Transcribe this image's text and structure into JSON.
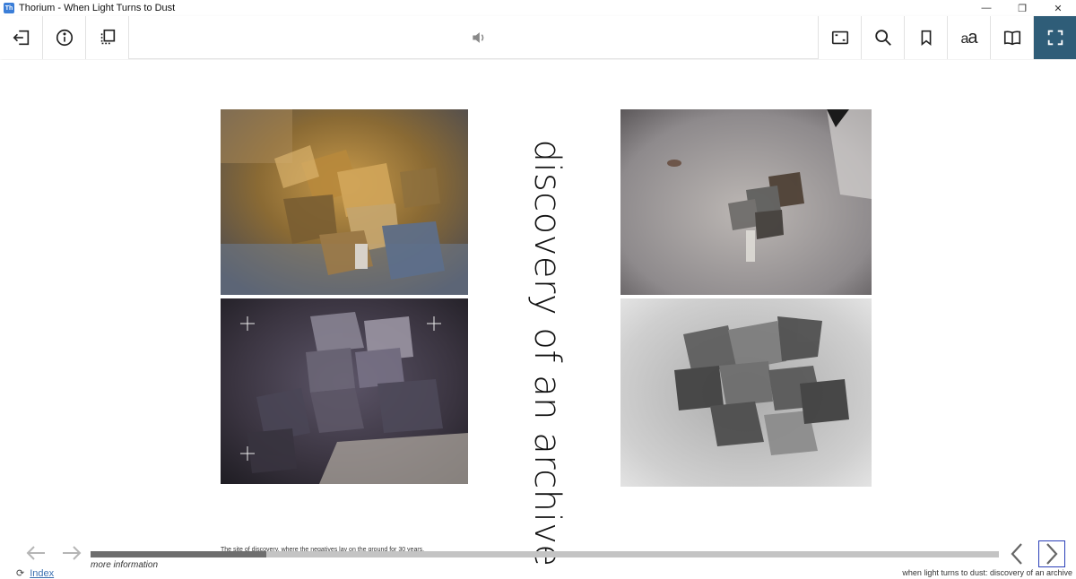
{
  "window": {
    "app_logo": "Th",
    "title": "Thorium - When Light Turns to Dust",
    "controls": [
      "minimize-icon",
      "restore-icon",
      "close-icon"
    ],
    "minimize_glyph": "—",
    "restore_glyph": "❐",
    "close_glyph": "✕"
  },
  "toolbar": {
    "left_buttons": [
      "back-to-library-icon",
      "info-icon",
      "pages-icon"
    ],
    "center_icon": "speaker-icon",
    "right_buttons": [
      "fit-page-icon",
      "search-icon",
      "bookmark-icon",
      "font-settings-icon",
      "toc-book-icon",
      "fullscreen-icon"
    ],
    "font_settings_label_small": "a",
    "font_settings_label_large": "a",
    "active_color": "#2f5d78"
  },
  "content": {
    "vertical_title": "discovery of an archive",
    "caption_left": "The site of discovery, where the negatives lay on the ground for 30 years.",
    "photos": [
      {
        "name": "photo-negatives-golden",
        "palette": "golden"
      },
      {
        "name": "photo-negatives-dark-purple",
        "palette": "dark"
      },
      {
        "name": "photo-negatives-gray-ground",
        "palette": "gray"
      },
      {
        "name": "photo-negatives-black-white",
        "palette": "bw"
      }
    ]
  },
  "footer": {
    "index_icon": "refresh-icon",
    "index_link": "Index",
    "right_title": "when light turns to dust: discovery of an archive"
  },
  "bottom": {
    "back_icon": "arrow-left-icon",
    "forward_icon": "arrow-right-icon",
    "progress": 0.193,
    "more_info": "more information",
    "prev_page_icon": "chevron-left-icon",
    "next_page_icon": "chevron-right-icon",
    "focus_color": "#2a3fb8"
  }
}
